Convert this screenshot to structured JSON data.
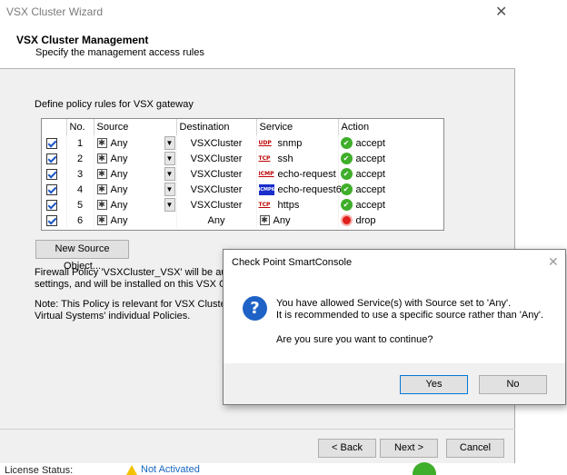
{
  "wizard": {
    "title": "VSX Cluster Wizard",
    "close_glyph": "✕",
    "header_title": "VSX Cluster Management",
    "header_subtitle": "Specify the management access rules",
    "define_label": "Define policy rules for VSX gateway",
    "new_source_button": "New Source Object...",
    "fw_policy_line1": "Firewall Policy 'VSXCluster_VSX' will be automatica",
    "fw_policy_line2": "settings, and will be installed on this VSX Cluster.",
    "note_line1": "Note: This Policy is relevant for VSX Cluster's acce",
    "note_line2": "Virtual Systems' individual Policies.",
    "back_button": "< Back",
    "next_button": "Next >",
    "cancel_button": "Cancel"
  },
  "table": {
    "headers": [
      "No.",
      "Source",
      "Destination",
      "Service",
      "Action"
    ],
    "rows": [
      {
        "checked": true,
        "no": "1",
        "source": "Any",
        "destination": "VSXCluster",
        "protocol": "UDP",
        "service": "snmp",
        "action": "accept"
      },
      {
        "checked": true,
        "no": "2",
        "source": "Any",
        "destination": "VSXCluster",
        "protocol": "TCP",
        "service": "ssh",
        "action": "accept"
      },
      {
        "checked": true,
        "no": "3",
        "source": "Any",
        "destination": "VSXCluster",
        "protocol": "ICMP",
        "service": "echo-request",
        "action": "accept"
      },
      {
        "checked": true,
        "no": "4",
        "source": "Any",
        "destination": "VSXCluster",
        "protocol": "ICMP6",
        "service": "echo-request6",
        "action": "accept"
      },
      {
        "checked": true,
        "no": "5",
        "source": "Any",
        "destination": "VSXCluster",
        "protocol": "TCP",
        "service": "https",
        "action": "accept"
      },
      {
        "checked": true,
        "no": "6",
        "source": "Any",
        "destination": "Any",
        "protocol": "",
        "service": "Any",
        "action": "drop"
      }
    ]
  },
  "status": {
    "license_label": "License Status:",
    "license_value": "Not Activated"
  },
  "dialog": {
    "title": "Check Point SmartConsole",
    "close_glyph": "✕",
    "message_line1": "You have allowed Service(s) with Source set to 'Any'.",
    "message_line2": "It is recommended to use a specific source rather than 'Any'.",
    "question": "Are you sure you want to continue?",
    "yes_button": "Yes",
    "no_button": "No"
  },
  "colors": {
    "accept": "#3fae2a",
    "drop": "#e0201a",
    "link": "#1565c0",
    "question_icon": "#1f62c7"
  }
}
